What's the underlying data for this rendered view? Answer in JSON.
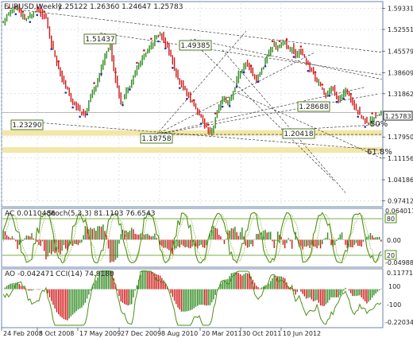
{
  "header": {
    "symbol": "EURUSD,Weekly",
    "ohlc": "1.25122 1.26360 1.24647 1.25783"
  },
  "colors": {
    "up": "#2e8b20",
    "down": "#d01818",
    "fib": "#f2e7a8",
    "osc": "#4f8f12",
    "grid": "#c6d2e2",
    "frame": "#6e86a8",
    "labelBorder": "#4f7a22",
    "bg": "#ffffff"
  },
  "chart_data": {
    "type": "candlestick",
    "title": "EURUSD,Weekly",
    "time_labels": [
      "24 Feb 2008",
      "5 Oct 2008",
      "17 May 2009",
      "27 Dec 2009",
      "8 Aug 2010",
      "20 Mar 2011",
      "30 Oct 2011",
      "10 Jun 2012"
    ],
    "price_axis": {
      "ticks": [
        "1.59331",
        "1.52551",
        "1.45579",
        "1.38609",
        "1.31862",
        "1.25783",
        "1.17950",
        "1.11156",
        "1.04186",
        "0.97412"
      ],
      "ylim": [
        0.96,
        1.61
      ]
    },
    "price_path": [
      [
        0,
        1.545
      ],
      [
        2,
        1.57
      ],
      [
        4,
        1.585
      ],
      [
        6,
        1.59
      ],
      [
        8,
        1.595
      ],
      [
        10,
        1.57
      ],
      [
        12,
        1.56
      ],
      [
        14,
        1.56
      ],
      [
        16,
        1.575
      ],
      [
        18,
        1.59
      ],
      [
        20,
        1.59
      ],
      [
        22,
        1.57
      ],
      [
        24,
        1.56
      ],
      [
        26,
        1.5
      ],
      [
        28,
        1.46
      ],
      [
        30,
        1.42
      ],
      [
        32,
        1.39
      ],
      [
        34,
        1.35
      ],
      [
        36,
        1.33
      ],
      [
        38,
        1.3
      ],
      [
        40,
        1.285
      ],
      [
        42,
        1.27
      ],
      [
        44,
        1.255
      ],
      [
        46,
        1.25
      ],
      [
        48,
        1.29
      ],
      [
        50,
        1.32
      ],
      [
        52,
        1.35
      ],
      [
        54,
        1.38
      ],
      [
        56,
        1.42
      ],
      [
        58,
        1.46
      ],
      [
        60,
        1.47
      ],
      [
        62,
        1.4
      ],
      [
        64,
        1.34
      ],
      [
        66,
        1.29
      ],
      [
        68,
        1.31
      ],
      [
        70,
        1.34
      ],
      [
        72,
        1.36
      ],
      [
        74,
        1.39
      ],
      [
        76,
        1.41
      ],
      [
        78,
        1.43
      ],
      [
        80,
        1.45
      ],
      [
        82,
        1.47
      ],
      [
        84,
        1.485
      ],
      [
        86,
        1.5
      ],
      [
        88,
        1.51
      ],
      [
        90,
        1.495
      ],
      [
        92,
        1.47
      ],
      [
        94,
        1.44
      ],
      [
        96,
        1.4
      ],
      [
        98,
        1.365
      ],
      [
        100,
        1.345
      ],
      [
        102,
        1.33
      ],
      [
        104,
        1.31
      ],
      [
        106,
        1.29
      ],
      [
        108,
        1.27
      ],
      [
        110,
        1.25
      ],
      [
        112,
        1.23
      ],
      [
        114,
        1.21
      ],
      [
        116,
        1.192
      ],
      [
        118,
        1.215
      ],
      [
        120,
        1.26
      ],
      [
        122,
        1.29
      ],
      [
        124,
        1.3
      ],
      [
        126,
        1.285
      ],
      [
        128,
        1.31
      ],
      [
        130,
        1.34
      ],
      [
        132,
        1.38
      ],
      [
        134,
        1.39
      ],
      [
        136,
        1.42
      ],
      [
        138,
        1.4
      ],
      [
        140,
        1.38
      ],
      [
        142,
        1.365
      ],
      [
        144,
        1.385
      ],
      [
        146,
        1.41
      ],
      [
        148,
        1.44
      ],
      [
        150,
        1.46
      ],
      [
        152,
        1.48
      ],
      [
        154,
        1.46
      ],
      [
        156,
        1.48
      ],
      [
        158,
        1.49
      ],
      [
        160,
        1.46
      ],
      [
        162,
        1.47
      ],
      [
        164,
        1.44
      ],
      [
        166,
        1.46
      ],
      [
        168,
        1.445
      ],
      [
        170,
        1.42
      ],
      [
        172,
        1.4
      ],
      [
        174,
        1.38
      ],
      [
        176,
        1.36
      ],
      [
        178,
        1.34
      ],
      [
        180,
        1.32
      ],
      [
        182,
        1.32
      ],
      [
        184,
        1.34
      ],
      [
        186,
        1.32
      ],
      [
        188,
        1.3
      ],
      [
        190,
        1.31
      ],
      [
        192,
        1.33
      ],
      [
        194,
        1.31
      ],
      [
        196,
        1.29
      ],
      [
        198,
        1.27
      ],
      [
        200,
        1.255
      ],
      [
        202,
        1.235
      ],
      [
        204,
        1.225
      ],
      [
        206,
        1.23
      ],
      [
        208,
        1.245
      ],
      [
        210,
        1.252
      ],
      [
        212,
        1.258
      ]
    ],
    "annotations": [
      "1.51437",
      "1.49385",
      "1.23290",
      "1.18758",
      "1.20418",
      "1.28688"
    ],
    "fib_labels": [
      "50%",
      "61.8%"
    ],
    "fib_levels": [
      1.1925,
      1.1375
    ],
    "last_price": "1.25783",
    "ac": {
      "label": "AC 0.0110486",
      "ticks": [
        "0.0640112",
        "0.00",
        "-0.04988"
      ],
      "ylim": [
        -0.07,
        0.08
      ]
    },
    "stoch": {
      "label": "Stoch(5,3,3) 81.1103 76.6543",
      "levels": [
        "80",
        "20"
      ]
    },
    "ao": {
      "label": "AO -0.042471",
      "ticks": [
        "0.11771",
        "100",
        "-100",
        "-0.22034"
      ],
      "ylim": [
        -0.25,
        0.13
      ]
    },
    "cci": {
      "label": "CCI(14) 74.9180"
    }
  }
}
